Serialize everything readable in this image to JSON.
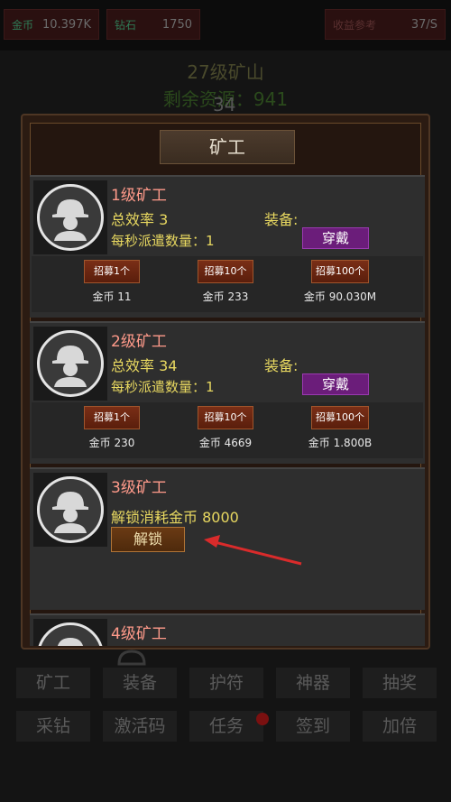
{
  "topbar": {
    "gold": {
      "label": "金币",
      "value": "10.397K"
    },
    "diamond": {
      "label": "钻石",
      "value": "1750"
    },
    "income": {
      "label": "收益参考",
      "value": "37/S"
    }
  },
  "mine": {
    "title": "27级矿山",
    "remaining": "剩余资源：941",
    "overlay_number": "34"
  },
  "modal": {
    "title": "矿工",
    "miners": [
      {
        "name": "1级矿工",
        "efficiency": "总效率 3",
        "rate": "每秒派遣数量：1",
        "equip_label": "装备:",
        "wear_label": "穿戴",
        "recruit": [
          {
            "label": "招募1个",
            "cost": "金币 11"
          },
          {
            "label": "招募10个",
            "cost": "金币 233"
          },
          {
            "label": "招募100个",
            "cost": "金币 90.030M"
          }
        ]
      },
      {
        "name": "2级矿工",
        "efficiency": "总效率 34",
        "rate": "每秒派遣数量：1",
        "equip_label": "装备:",
        "wear_label": "穿戴",
        "recruit": [
          {
            "label": "招募1个",
            "cost": "金币 230"
          },
          {
            "label": "招募10个",
            "cost": "金币 4669"
          },
          {
            "label": "招募100个",
            "cost": "金币 1.800B"
          }
        ]
      },
      {
        "name": "3级矿工",
        "unlock_cost": "解锁消耗金币 8000",
        "unlock_label": "解锁"
      },
      {
        "name": "4级矿工"
      }
    ]
  },
  "annotation": {
    "arrow_color": "#d92b2b"
  },
  "menu": {
    "row1": [
      "矿工",
      "装备",
      "护符",
      "神器",
      "抽奖"
    ],
    "row2": [
      "采钻",
      "激活码",
      "任务",
      "签到",
      "加倍"
    ]
  }
}
